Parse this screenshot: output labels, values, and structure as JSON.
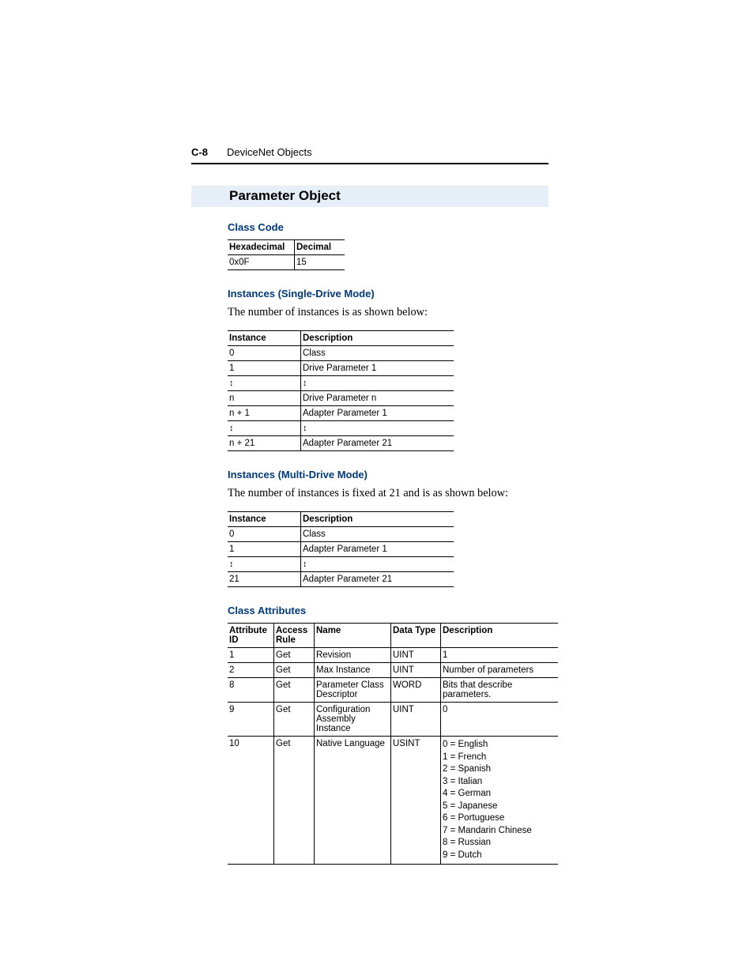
{
  "header": {
    "page_number": "C-8",
    "section_title": "DeviceNet Objects"
  },
  "title": "Parameter Object",
  "class_code": {
    "heading": "Class Code",
    "headers": {
      "hex": "Hexadecimal",
      "dec": "Decimal"
    },
    "values": {
      "hex": "0x0F",
      "dec": "15"
    }
  },
  "instances_single": {
    "heading": "Instances (Single-Drive Mode)",
    "intro": "The number of instances is as shown below:",
    "headers": {
      "instance": "Instance",
      "description": "Description"
    },
    "rows": [
      {
        "instance": "0",
        "description": "Class"
      },
      {
        "instance": "1",
        "description": "Drive Parameter 1"
      },
      {
        "instance": "↕",
        "description": "↕"
      },
      {
        "instance": "n",
        "description": "Drive Parameter n"
      },
      {
        "instance": "n + 1",
        "description": "Adapter Parameter 1"
      },
      {
        "instance": "↕",
        "description": "↕"
      },
      {
        "instance": "n + 21",
        "description": "Adapter Parameter 21"
      }
    ]
  },
  "instances_multi": {
    "heading": "Instances (Multi-Drive Mode)",
    "intro": "The number of instances is fixed at 21 and is as shown below:",
    "headers": {
      "instance": "Instance",
      "description": "Description"
    },
    "rows": [
      {
        "instance": "0",
        "description": "Class"
      },
      {
        "instance": "1",
        "description": "Adapter Parameter 1"
      },
      {
        "instance": "↕",
        "description": "↕"
      },
      {
        "instance": "21",
        "description": "Adapter Parameter 21"
      }
    ]
  },
  "class_attributes": {
    "heading": "Class Attributes",
    "headers": {
      "attr_id": "Attribute ID",
      "access": "Access Rule",
      "name": "Name",
      "data_type": "Data Type",
      "description": "Description"
    },
    "rows": [
      {
        "attr_id": "1",
        "access": "Get",
        "name": "Revision",
        "data_type": "UINT",
        "description": "1"
      },
      {
        "attr_id": "2",
        "access": "Get",
        "name": "Max Instance",
        "data_type": "UINT",
        "description": "Number of parameters"
      },
      {
        "attr_id": "8",
        "access": "Get",
        "name": "Parameter Class Descriptor",
        "data_type": "WORD",
        "description": "Bits that describe parameters."
      },
      {
        "attr_id": "9",
        "access": "Get",
        "name": "Configuration Assembly Instance",
        "data_type": "UINT",
        "description": "0"
      },
      {
        "attr_id": "10",
        "access": "Get",
        "name": "Native Language",
        "data_type": "USINT",
        "description": "0 = English\n1 = French\n2 = Spanish\n3 = Italian\n4 = German\n5 = Japanese\n6 = Portuguese\n7 = Mandarin Chinese\n8 = Russian\n9 = Dutch"
      }
    ]
  }
}
